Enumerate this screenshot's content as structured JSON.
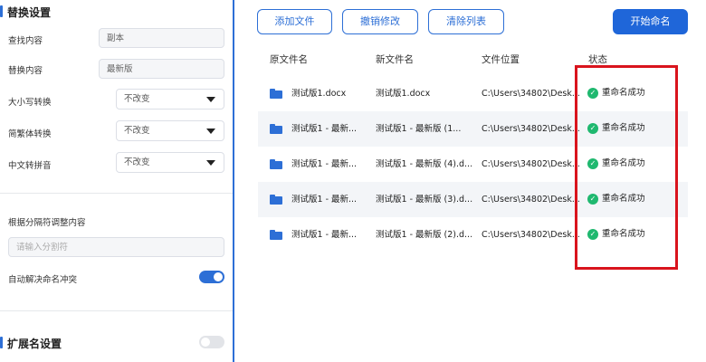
{
  "replace_settings": {
    "title": "替换设置",
    "find_label": "查找内容",
    "find_value": "副本",
    "replace_label": "替换内容",
    "replace_value": "最新版",
    "case_label": "大小写转换",
    "case_value": "不改变",
    "trad_label": "简繁体转换",
    "trad_value": "不改变",
    "pinyin_label": "中文转拼音",
    "pinyin_value": "不改变",
    "separator_label": "根据分隔符调整内容",
    "separator_placeholder": "请输入分割符",
    "conflict_label": "自动解决命名冲突",
    "conflict_on": true
  },
  "ext_settings": {
    "title": "扩展名设置",
    "enabled": false
  },
  "toolbar": {
    "add_files": "添加文件",
    "undo": "撤销修改",
    "clear": "清除列表",
    "start": "开始命名"
  },
  "table": {
    "headers": [
      "原文件名",
      "新文件名",
      "文件位置",
      "状态"
    ],
    "rows": [
      {
        "original": "测试版1.docx",
        "new": "测试版1.docx",
        "location": "C:\\Users\\34802\\Desk...",
        "status": "重命名成功"
      },
      {
        "original": "测试版1 - 最新...",
        "new": "测试版1 - 最新版 (1...",
        "location": "C:\\Users\\34802\\Desk...",
        "status": "重命名成功"
      },
      {
        "original": "测试版1 - 最新...",
        "new": "测试版1 - 最新版 (4).d...",
        "location": "C:\\Users\\34802\\Desk...",
        "status": "重命名成功"
      },
      {
        "original": "测试版1 - 最新...",
        "new": "测试版1 - 最新版 (3).d...",
        "location": "C:\\Users\\34802\\Desk...",
        "status": "重命名成功"
      },
      {
        "original": "测试版1 - 最新...",
        "new": "测试版1 - 最新版 (2).d...",
        "location": "C:\\Users\\34802\\Desk...",
        "status": "重命名成功"
      }
    ]
  },
  "colors": {
    "accent": "#2d6fd6",
    "success": "#1fb86f",
    "highlight": "#d9141d"
  },
  "icons": {
    "file": "folder-icon",
    "status": "check-circle-icon",
    "dropdown": "caret-down-icon"
  }
}
